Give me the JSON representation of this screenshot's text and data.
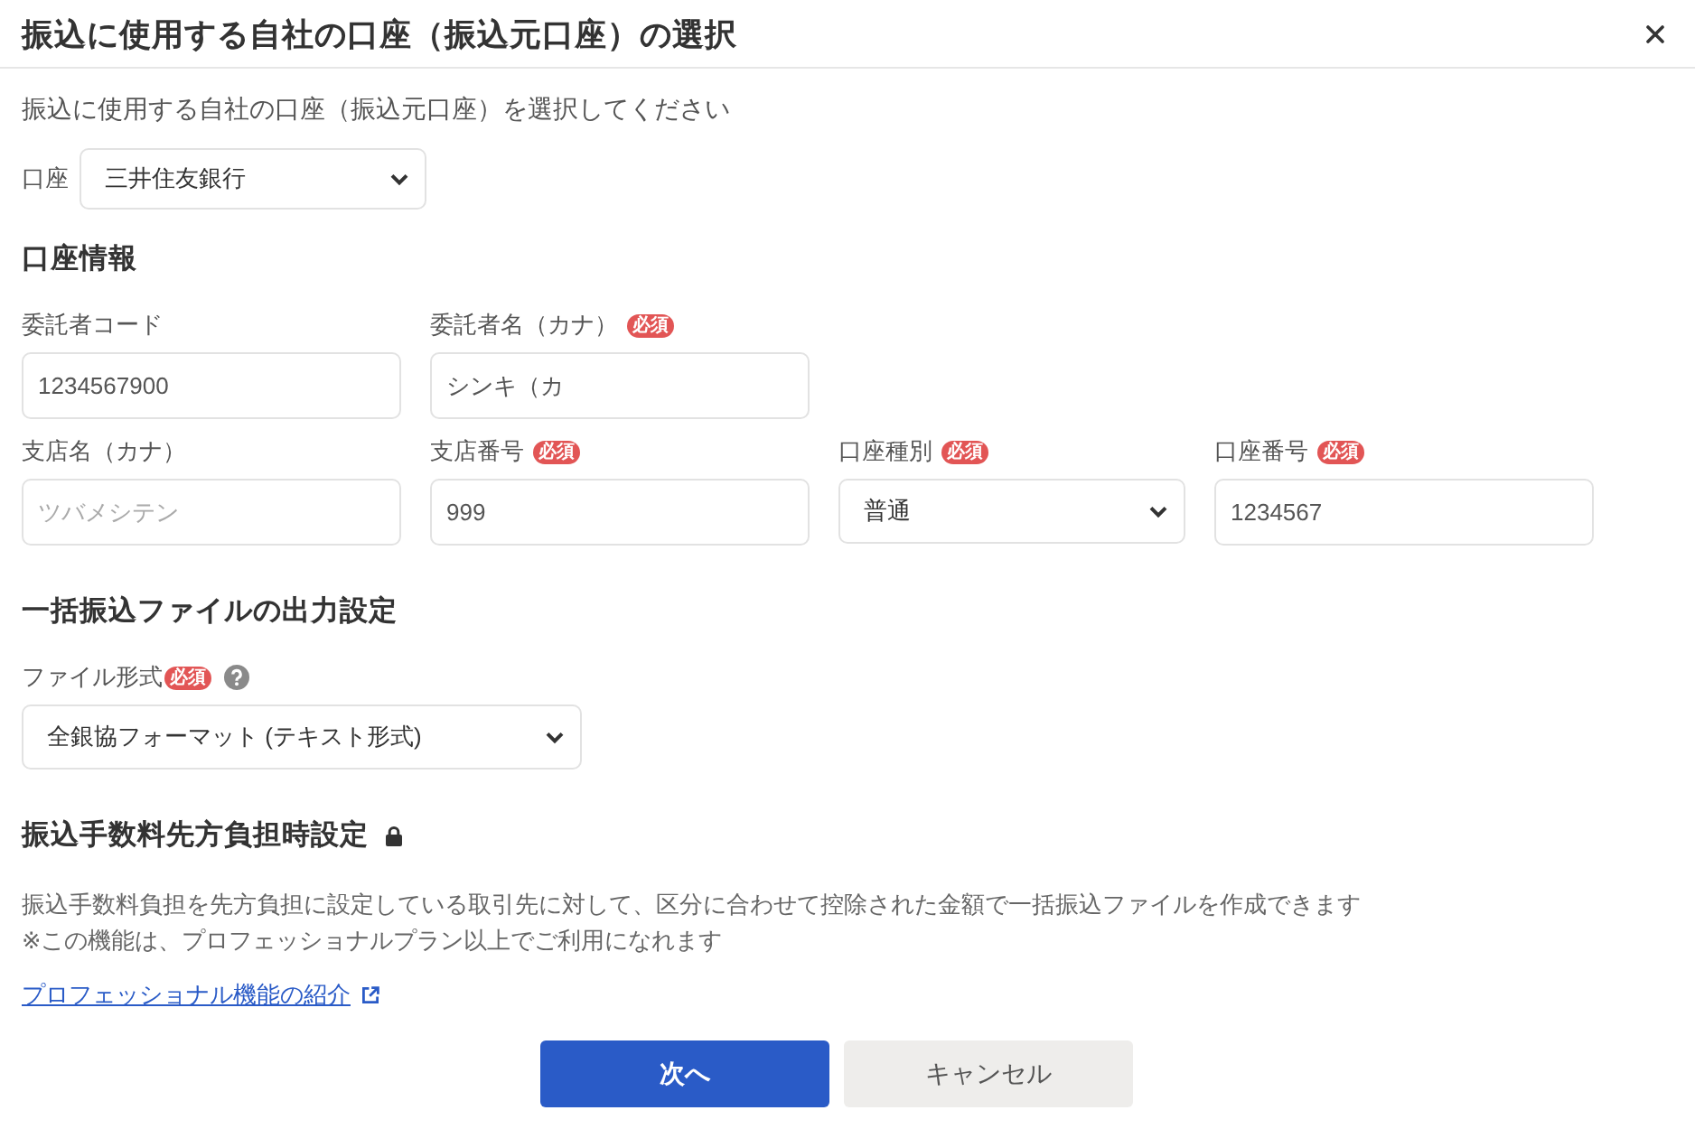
{
  "dialog": {
    "title": "振込に使用する自社の口座（振込元口座）の選択"
  },
  "intro": "振込に使用する自社の口座（振込元口座）を選択してください",
  "account": {
    "label": "口座",
    "value": "三井住友銀行"
  },
  "account_info": {
    "heading": "口座情報",
    "rows": [
      [
        {
          "label": "委託者コード",
          "kind": "input",
          "value": "1234567900"
        },
        {
          "label": "委託者名（カナ）",
          "badge": "必須",
          "kind": "input",
          "value": "シンキ（カ"
        }
      ],
      [
        {
          "label": "支店名（カナ）",
          "kind": "input",
          "placeholder": "ツバメシテン"
        },
        {
          "label": "支店番号",
          "badge": "必須",
          "kind": "input",
          "value": "999"
        },
        {
          "label": "口座種別",
          "badge": "必須",
          "kind": "select",
          "value": "普通"
        },
        {
          "label": "口座番号",
          "badge": "必須",
          "kind": "input",
          "value": "1234567"
        }
      ]
    ]
  },
  "file_output": {
    "heading": "一括振込ファイルの出力設定",
    "field": {
      "label": "ファイル形式",
      "badge": "必須",
      "help": true,
      "kind": "select",
      "value": "全銀協フォーマット (テキスト形式)"
    }
  },
  "fee_setting": {
    "heading": "振込手数料先方負担時設定",
    "locked": true,
    "notes": [
      "振込手数料負担を先方負担に設定している取引先に対して、区分に合わせて控除された金額で一括振込ファイルを作成できます",
      "※この機能は、プロフェッショナルプラン以上でご利用になれます"
    ],
    "link": {
      "label": "プロフェッショナル機能の紹介",
      "external": true
    }
  },
  "buttons": [
    {
      "label": "次へ",
      "kind": "primary"
    },
    {
      "label": "キャンセル",
      "kind": "secondary"
    }
  ]
}
